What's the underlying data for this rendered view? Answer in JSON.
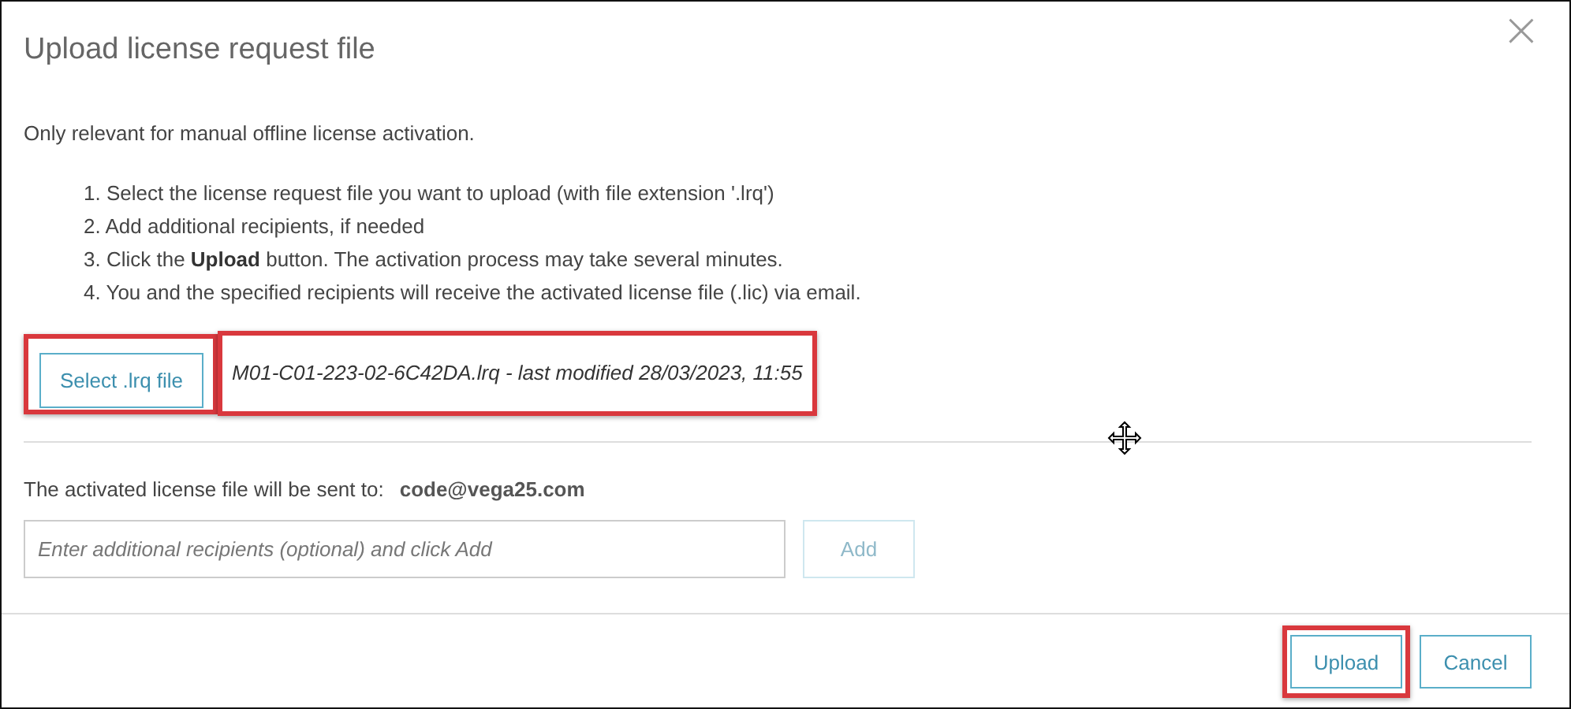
{
  "dialog": {
    "title": "Upload license request file",
    "close": "×",
    "intro": "Only relevant for manual offline license activation.",
    "steps": [
      "1. Select the license request file you want to upload (with file extension '.lrq')",
      "2. Add additional recipients, if needed",
      "3. Click the **Upload** button. The activation process may take several minutes.",
      "4. You and the specified recipients will receive the activated license file (.lic) via email."
    ],
    "select_button": {
      "label": "Select .lrq file",
      "highlighted": true
    },
    "file_info": {
      "text": "M01-C01-223-02-6C42DA.lrq - last modified 28/03/2023, 11:55",
      "highlighted": true
    },
    "recipient_label": "The activated license file will be sent to:",
    "recipient_email": "code@vega25.com",
    "recipients_field": {
      "placeholder": "Enter additional recipients (optional) and click Add"
    },
    "add_button": {
      "label": "Add",
      "disabled": true
    },
    "footer_buttons": [
      {
        "label": "Upload",
        "highlighted": true
      },
      {
        "label": "Cancel",
        "highlighted": false
      }
    ]
  }
}
